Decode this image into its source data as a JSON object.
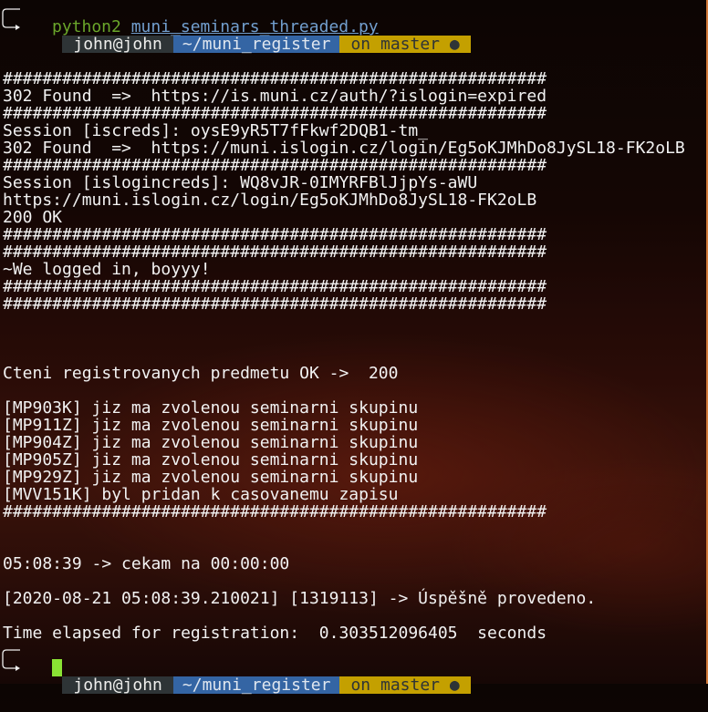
{
  "prompt": {
    "user": "john@john",
    "dir": "~/muni_register",
    "git": "on master ●"
  },
  "command": {
    "interpreter": "python2",
    "file": "muni_seminars_threaded.py"
  },
  "output": [
    "",
    "",
    "#######################################################",
    "302 Found  =>  https://is.muni.cz/auth/?islogin=expired",
    "#######################################################",
    "Session [iscreds]: oysE9yR5T7fFkwf2DQB1-tm_",
    "302 Found  =>  https://muni.islogin.cz/login/Eg5oKJMhDo8JySL18-FK2oLB",
    "#######################################################",
    "Session [islogincreds]: WQ8vJR-0IMYRFBlJjpYs-aWU",
    "https://muni.islogin.cz/login/Eg5oKJMhDo8JySL18-FK2oLB",
    "200 OK",
    "#######################################################",
    "#######################################################",
    "~We logged in, boyyy!",
    "#######################################################",
    "#######################################################",
    "",
    "",
    "",
    "Cteni registrovanych predmetu OK ->  200",
    "",
    "[MP903K] jiz ma zvolenou seminarni skupinu",
    "[MP911Z] jiz ma zvolenou seminarni skupinu",
    "[MP904Z] jiz ma zvolenou seminarni skupinu",
    "[MP905Z] jiz ma zvolenou seminarni skupinu",
    "[MP929Z] jiz ma zvolenou seminarni skupinu",
    "[MVV151K] byl pridan k casovanemu zapisu",
    "#######################################################",
    "",
    "",
    "05:08:39 -> cekam na 00:00:00",
    "",
    "[2020-08-21 05:08:39.210021] [1319113] -> Úspěšně provedeno.",
    "",
    "Time elapsed for registration:  0.303512096405  seconds"
  ]
}
